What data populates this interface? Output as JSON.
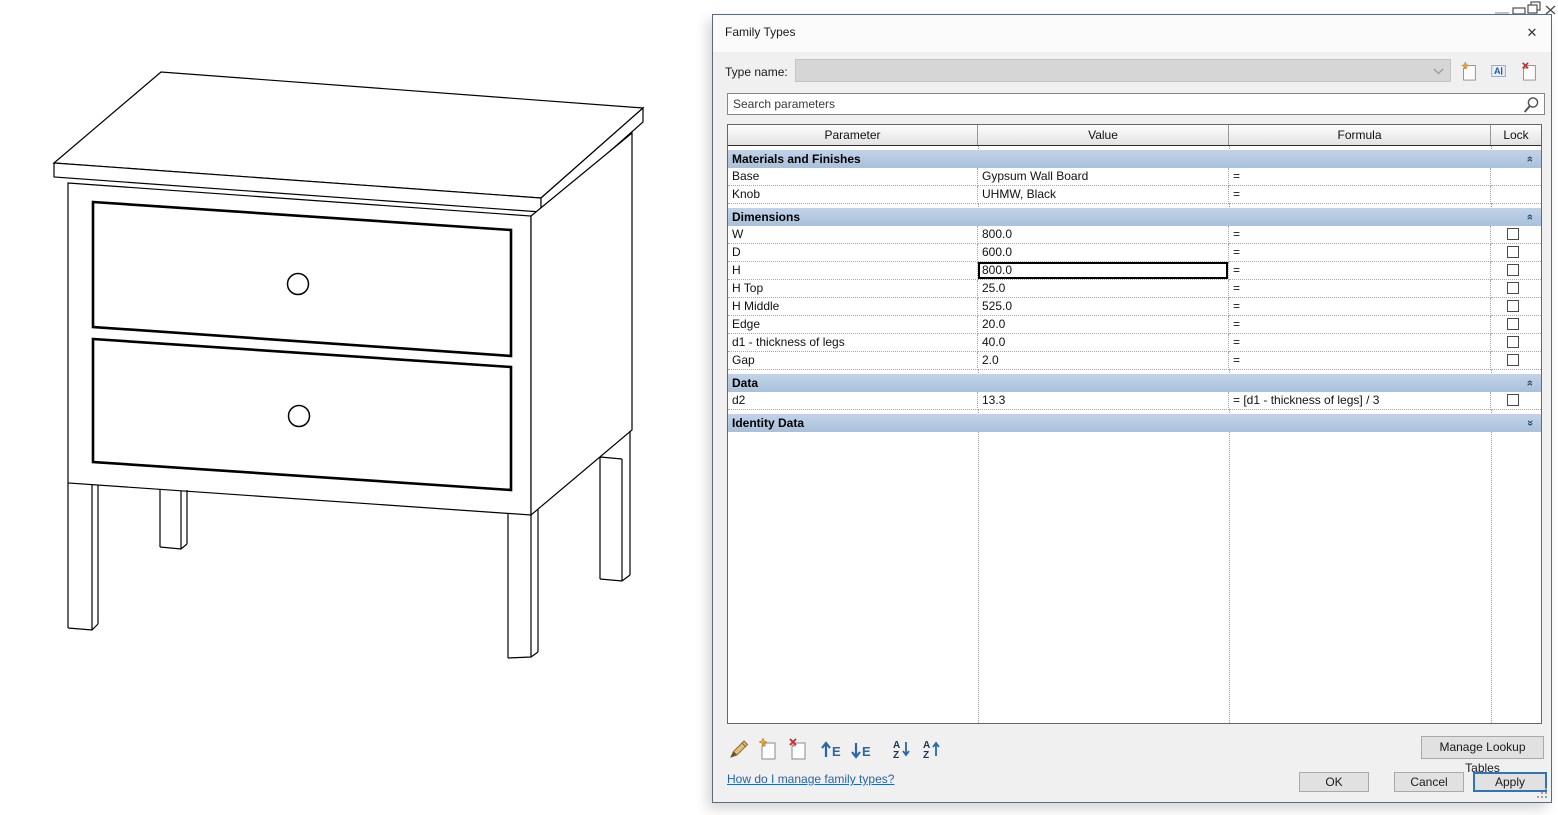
{
  "dialog": {
    "title": "Family Types",
    "type_name_label": "Type name:",
    "type_name_value": "",
    "search_placeholder": "Search parameters",
    "columns": [
      "Parameter",
      "Value",
      "Formula",
      "Lock"
    ],
    "sections": [
      {
        "name": "Materials and Finishes",
        "collapsed": false,
        "rows": [
          {
            "parameter": "Base",
            "value": "Gypsum Wall Board",
            "formula": "=",
            "lock": null
          },
          {
            "parameter": "Knob",
            "value": "UHMW, Black",
            "formula": "=",
            "lock": null
          }
        ]
      },
      {
        "name": "Dimensions",
        "collapsed": false,
        "rows": [
          {
            "parameter": "W",
            "value": "800.0",
            "formula": "=",
            "lock": false
          },
          {
            "parameter": "D",
            "value": "600.0",
            "formula": "=",
            "lock": false
          },
          {
            "parameter": "H",
            "value": "800.0",
            "formula": "=",
            "lock": false,
            "editing": true
          },
          {
            "parameter": "H Top",
            "value": "25.0",
            "formula": "=",
            "lock": false
          },
          {
            "parameter": "H Middle",
            "value": "525.0",
            "formula": "=",
            "lock": false
          },
          {
            "parameter": "Edge",
            "value": "20.0",
            "formula": "=",
            "lock": false
          },
          {
            "parameter": "d1 - thickness of legs",
            "value": "40.0",
            "formula": "=",
            "lock": false
          },
          {
            "parameter": "Gap",
            "value": "2.0",
            "formula": "=",
            "lock": false
          }
        ]
      },
      {
        "name": "Data",
        "collapsed": false,
        "rows": [
          {
            "parameter": "d2",
            "value": "13.3",
            "formula": "= [d1 - thickness of legs] / 3",
            "lock": false
          }
        ]
      },
      {
        "name": "Identity Data",
        "collapsed": true,
        "rows": []
      }
    ],
    "manage_lookup_tables": "Manage Lookup Tables",
    "help_link": "How do I manage family types?",
    "buttons": {
      "ok": "OK",
      "cancel": "Cancel",
      "apply": "Apply"
    }
  },
  "icons": {
    "chevron_pair": "»",
    "close": "✕",
    "move_letter": "E",
    "sort_top": "A",
    "sort_bottom": "Z"
  },
  "colors": {
    "section_bar": "#aec6df",
    "link": "#2564af",
    "apply_focus_border": "#2e75b6",
    "dialog_bg": "#f0f0f0"
  }
}
